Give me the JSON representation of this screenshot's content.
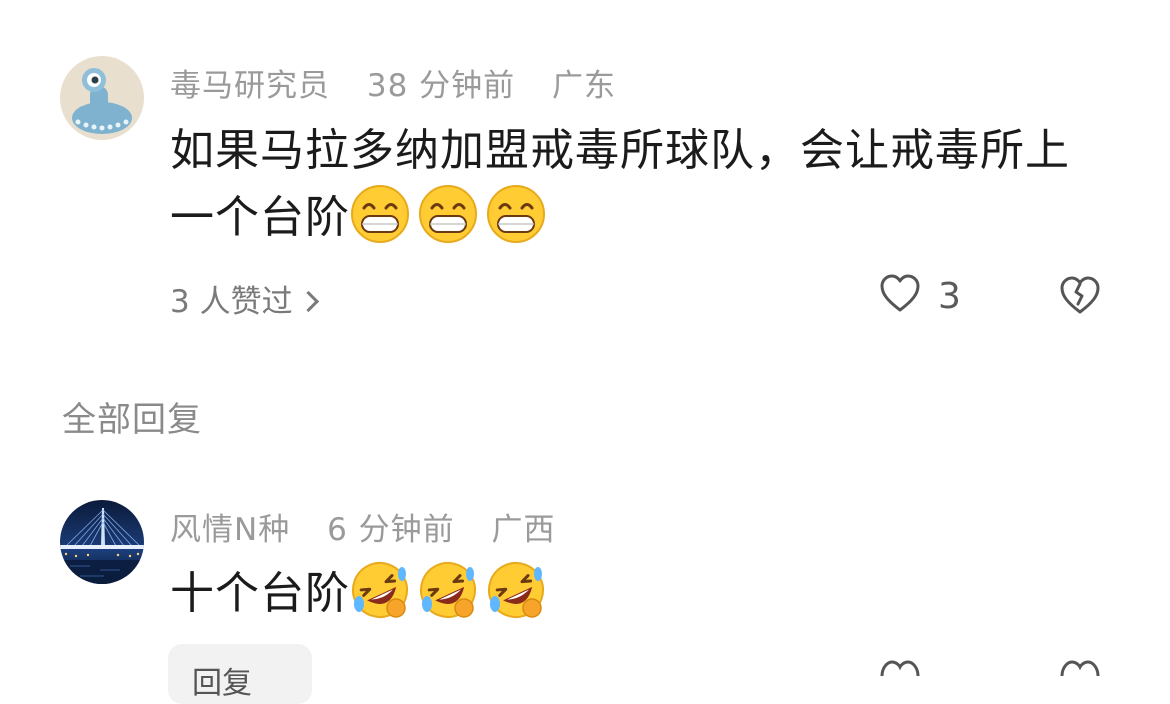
{
  "comments": [
    {
      "username": "毒马研究员",
      "time": "38 分钟前",
      "location": "广东",
      "text": "如果马拉多纳加盟戒毒所球队，会让戒毒所上一个台阶",
      "emojis": [
        "grin-emoji",
        "grin-emoji",
        "grin-emoji"
      ],
      "liked_by": "3 人赞过",
      "like_count": "3"
    },
    {
      "username": "风情N种",
      "time": "6 分钟前",
      "location": "广西",
      "text": "十个台阶",
      "emojis": [
        "rofl-emoji",
        "rofl-emoji",
        "rofl-emoji"
      ],
      "reply_label": "回复"
    }
  ],
  "section": {
    "all_replies": "全部回复"
  },
  "colors": {
    "meta_text": "#9a9a9a",
    "body_text": "#1b1b1b",
    "icon_stroke": "#555555"
  },
  "icons": [
    "heart-outline-icon",
    "broken-heart-icon",
    "chevron-right-icon"
  ]
}
